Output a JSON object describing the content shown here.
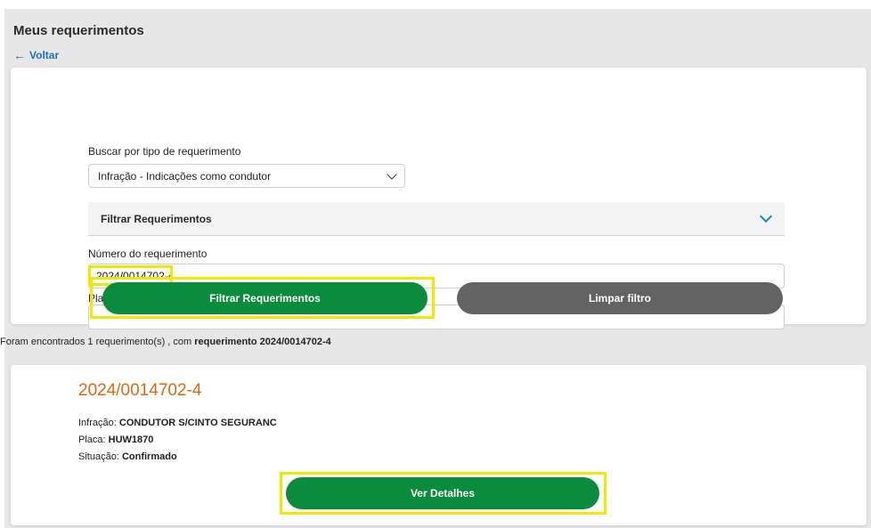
{
  "page": {
    "title": "Meus requerimentos",
    "back_label": "Voltar"
  },
  "filter": {
    "type_label": "Buscar por tipo de requerimento",
    "type_value": "Infração - Indicações como condutor",
    "accordion_label": "Filtrar Requerimentos",
    "number_label": "Número do requerimento",
    "number_value": "2024/0014702-4",
    "plate_label": "Placa do veículo",
    "plate_value": "",
    "filter_button": "Filtrar Requerimentos",
    "clear_button": "Limpar filtro"
  },
  "results": {
    "summary_prefix": "Foram encontrados 1 requerimento(s) , com ",
    "summary_bold": "requerimento 2024/0014702-4",
    "items": [
      {
        "number": "2024/0014702-4",
        "infraction_label": "Infração:",
        "infraction_value": "CONDUTOR S/CINTO SEGURANC",
        "plate_label": "Placa:",
        "plate_value": "HUW1870",
        "status_label": "Situação:",
        "status_value": "Confirmado",
        "details_button": "Ver Detalhes"
      }
    ]
  },
  "colors": {
    "primary_green": "#0a8c3c",
    "secondary_gray": "#636363",
    "link_blue": "#1a73b8",
    "accent_orange": "#d36b16",
    "highlight_yellow": "#f3e600"
  }
}
